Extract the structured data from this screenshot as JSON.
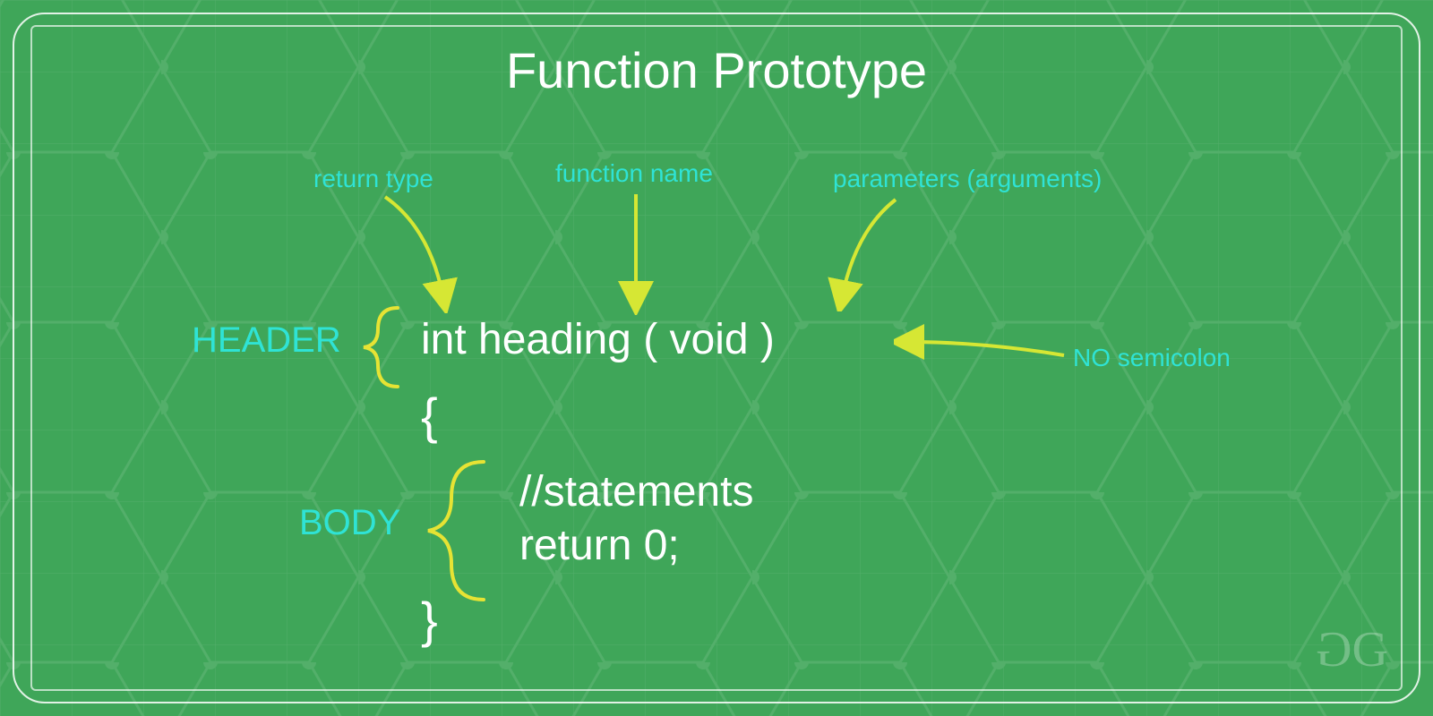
{
  "title": "Function Prototype",
  "labels": {
    "return_type": "return type",
    "function_name": "function name",
    "parameters": "parameters (arguments)",
    "no_semicolon": "NO semicolon"
  },
  "sections": {
    "header": "HEADER",
    "body": "BODY"
  },
  "code": {
    "signature": "int heading ( void )",
    "open_brace": "{",
    "body_line1": "//statements",
    "body_line2": "return 0;",
    "close_brace": "}"
  },
  "logo": {
    "left": "G",
    "right": "G"
  },
  "colors": {
    "arrow": "#d6e734",
    "brace": "#e6e334"
  }
}
